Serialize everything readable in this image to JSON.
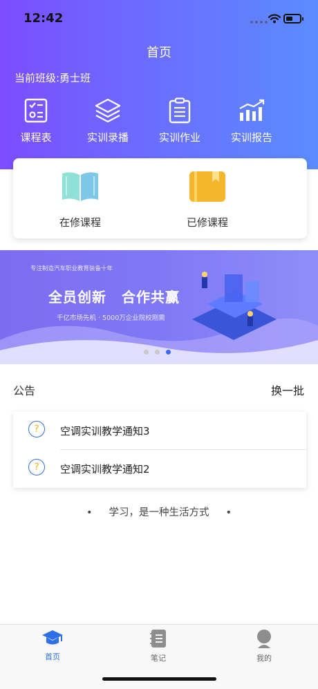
{
  "status_bar": {
    "time": "12:42"
  },
  "header": {
    "title": "首页",
    "class_label": "当前班级:勇士班"
  },
  "quick_menu": [
    {
      "label": "课程表",
      "icon": "schedule-icon"
    },
    {
      "label": "实训录播",
      "icon": "layers-icon"
    },
    {
      "label": "实训作业",
      "icon": "clipboard-icon"
    },
    {
      "label": "实训报告",
      "icon": "bar-chart-icon"
    }
  ],
  "courses": [
    {
      "label": "在修课程",
      "icon": "open-book-icon",
      "color": "#7fd3d0"
    },
    {
      "label": "已修课程",
      "icon": "closed-book-icon",
      "color": "#f5b52c"
    }
  ],
  "banner": {
    "subtitle": "专注制造汽车职业教育装备十年",
    "headline_1": "全员创新",
    "headline_2": "合作共赢",
    "tagline": "千亿市场先机 · 5000万企业院校刚需",
    "slide_count": 3,
    "active_slide": 3
  },
  "notices": {
    "title": "公告",
    "refresh_label": "换一批",
    "items": [
      {
        "text": "空调实训教学通知3"
      },
      {
        "text": "空调实训教学通知2"
      }
    ]
  },
  "slogan": {
    "text": "学习，是一种生活方式",
    "dot": "•"
  },
  "tabbar": {
    "items": [
      {
        "label": "首页",
        "icon": "graduation-cap-icon",
        "active": true
      },
      {
        "label": "笔记",
        "icon": "notebook-icon",
        "active": false
      },
      {
        "label": "我的",
        "icon": "user-avatar-icon",
        "active": false
      }
    ]
  },
  "colors": {
    "accent": "#2f6fe8",
    "header_start": "#7c4dff",
    "header_end": "#5b8cff"
  }
}
